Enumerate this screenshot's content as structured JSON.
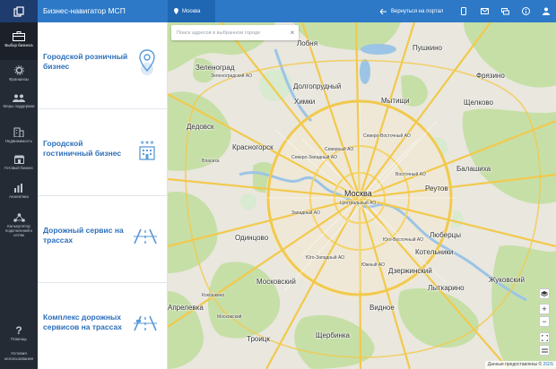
{
  "header": {
    "title": "Бизнес-навигатор МСП",
    "location": "Москва",
    "back_portal": "Вернуться на портал"
  },
  "sidebar": {
    "items": [
      {
        "label": "Выбор бизнеса",
        "icon": "briefcase-icon",
        "active": true
      },
      {
        "label": "Франшизы",
        "icon": "gear-icon"
      },
      {
        "label": "Меры поддержки",
        "icon": "people-icon"
      },
      {
        "label": "Недвижимость",
        "icon": "building-icon"
      },
      {
        "label": "Готовый бизнес",
        "icon": "shop-icon"
      },
      {
        "label": "Аналитика",
        "icon": "bar-chart-icon"
      },
      {
        "label": "Калькулятор подключений к сетям",
        "icon": "network-icon"
      }
    ],
    "help": "Помощь",
    "terms": "Условия использования"
  },
  "categories": [
    {
      "label": "Городской розничный бизнес",
      "icon": "location-pin-icon"
    },
    {
      "label": "Городской гостиничный бизнес",
      "icon": "hotel-icon"
    },
    {
      "label": "Дорожный сервис на трассах",
      "icon": "road-icon"
    },
    {
      "label": "Комплекс дорожных сервисов на трассах",
      "icon": "road-service-icon"
    }
  ],
  "map": {
    "search_placeholder": "Поиск адресов в выбранном городе",
    "attribution_prefix": "Данные предоставлены ©",
    "attribution_brand": "2GIS",
    "places": [
      {
        "name": "Лобня"
      },
      {
        "name": "Пушкино"
      },
      {
        "name": "Зеленоград"
      },
      {
        "name": "Долгопрудный"
      },
      {
        "name": "Мытищи"
      },
      {
        "name": "Фрязино"
      },
      {
        "name": "Химки"
      },
      {
        "name": "Щелково"
      },
      {
        "name": "Дедовск"
      },
      {
        "name": "Красногорск"
      },
      {
        "name": "Балашиха"
      },
      {
        "name": "Москва"
      },
      {
        "name": "Реутов"
      },
      {
        "name": "Одинцово"
      },
      {
        "name": "Люберцы"
      },
      {
        "name": "Котельники"
      },
      {
        "name": "Московский"
      },
      {
        "name": "Дзержинский"
      },
      {
        "name": "Жуковский"
      },
      {
        "name": "Лыткарино"
      },
      {
        "name": "Апрелевка"
      },
      {
        "name": "Видное"
      },
      {
        "name": "Троицк"
      },
      {
        "name": "Щербинка"
      },
      {
        "name": "Кокошкино"
      },
      {
        "name": "Московский"
      },
      {
        "name": "Власиха"
      }
    ],
    "districts": [
      {
        "name": "Северо-Западный АО"
      },
      {
        "name": "Северный АО"
      },
      {
        "name": "Северо-Восточный АО"
      },
      {
        "name": "Восточный АО"
      },
      {
        "name": "Центральный АО"
      },
      {
        "name": "Западный АО"
      },
      {
        "name": "Юго-Западный АО"
      },
      {
        "name": "Юго-Восточный АО"
      },
      {
        "name": "Южный АО"
      },
      {
        "name": "Зеленоградский АО"
      }
    ]
  }
}
